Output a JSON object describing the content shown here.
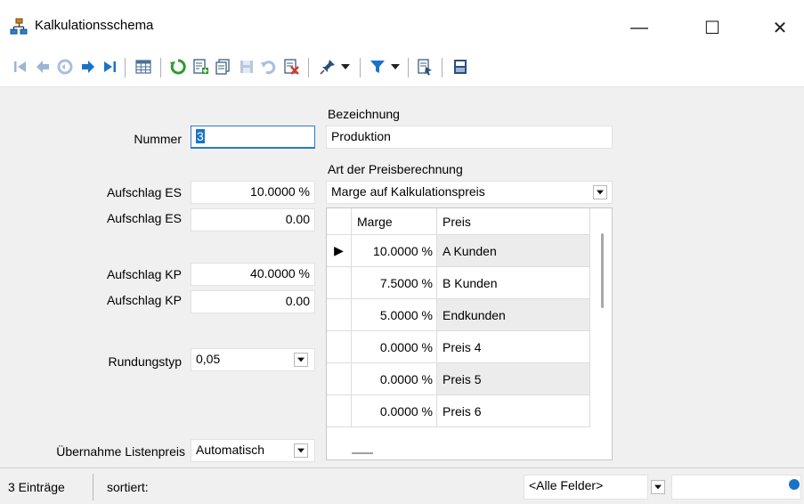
{
  "window": {
    "title": "Kalkulationsschema",
    "minimize": "—",
    "maximize": "☐",
    "close": "✕"
  },
  "toolbar": {
    "buttons": [
      "first-record-icon",
      "previous-record-icon",
      "refresh-disabled-icon",
      "next-record-icon",
      "last-record-icon",
      "table-view-icon",
      "refresh-icon",
      "new-record-icon",
      "copy-record-icon",
      "save-icon",
      "undo-icon",
      "delete-icon",
      "pin-icon",
      "filter-icon",
      "export-icon",
      "print-layout-icon"
    ]
  },
  "form": {
    "nummer": {
      "label": "Nummer",
      "value": "3"
    },
    "bezeichnung": {
      "label": "Bezeichnung",
      "value": "Produktion"
    },
    "art": {
      "label": "Art der Preisberechnung",
      "value": "Marge auf Kalkulationspreis"
    },
    "aufschlag_es_pct": {
      "label": "Aufschlag ES",
      "value": "10.0000 %"
    },
    "aufschlag_es_abs": {
      "label": "Aufschlag ES",
      "value": "0.00"
    },
    "aufschlag_kp_pct": {
      "label": "Aufschlag KP",
      "value": "40.0000 %"
    },
    "aufschlag_kp_abs": {
      "label": "Aufschlag KP",
      "value": "0.00"
    },
    "rundungstyp": {
      "label": "Rundungstyp",
      "value": "0,05"
    },
    "uebernahme": {
      "label": "Übernahme Listenpreis",
      "value": "Automatisch"
    }
  },
  "grid": {
    "columns": [
      "Marge",
      "Preis"
    ],
    "rows": [
      {
        "marge": "10.0000 %",
        "preis": "A Kunden",
        "current": true,
        "marker": "▶"
      },
      {
        "marge": "7.5000 %",
        "preis": "B Kunden"
      },
      {
        "marge": "5.0000 %",
        "preis": "Endkunden"
      },
      {
        "marge": "0.0000 %",
        "preis": "Preis 4"
      },
      {
        "marge": "0.0000 %",
        "preis": "Preis 5"
      },
      {
        "marge": "0.0000 %",
        "preis": "Preis 6"
      }
    ]
  },
  "status": {
    "count": "3 Einträge",
    "sorted": "sortiert:",
    "field_filter": "<Alle Felder>"
  },
  "colors": {
    "accent": "#1a73c8",
    "refresh": "#2e9a2e",
    "delete": "#d23b2b"
  }
}
